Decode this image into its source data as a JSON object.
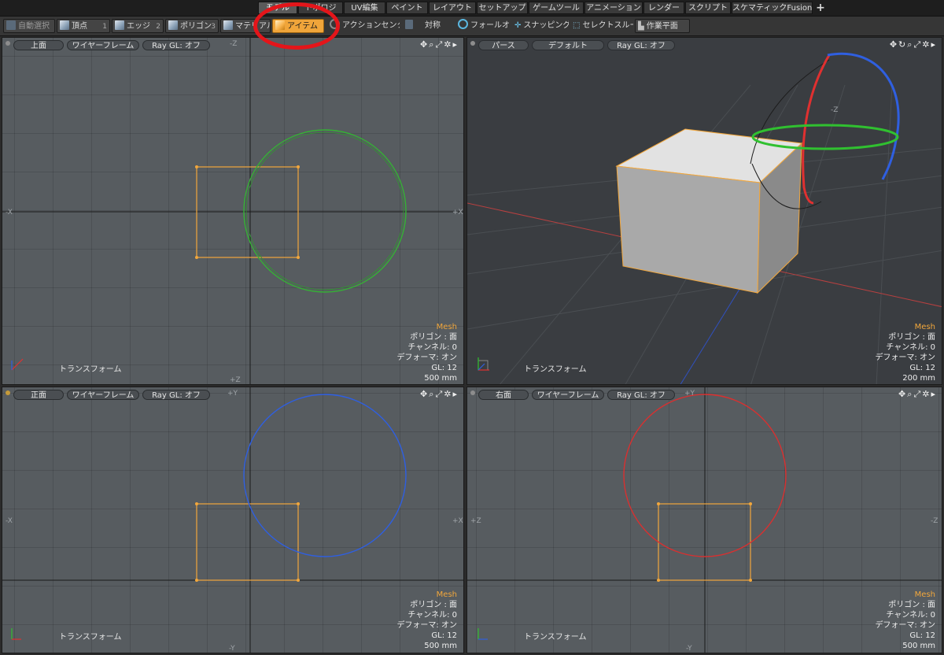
{
  "tabs": [
    {
      "label": "モデル",
      "active": true
    },
    {
      "label": "トポロジ",
      "active": false
    },
    {
      "label": "UV編集",
      "active": false
    },
    {
      "label": "ペイント",
      "active": false
    },
    {
      "label": "レイアウト",
      "active": false
    },
    {
      "label": "セットアップ",
      "active": false
    },
    {
      "label": "ゲームツール",
      "active": false
    },
    {
      "label": "アニメーション",
      "active": false
    },
    {
      "label": "レンダー",
      "active": false
    },
    {
      "label": "スクリプト",
      "active": false
    },
    {
      "label": "スケマティックFusion",
      "active": false
    }
  ],
  "tab_add_label": "+",
  "toolbar": {
    "auto_select": "自動選択",
    "vertex": "頂点",
    "vertex_key": "1",
    "edge": "エッジ",
    "edge_key": "2",
    "polygon": "ポリゴン",
    "polygon_key": "3",
    "material": "マテリアル",
    "item": "アイテム",
    "action_center": "アクションセンター",
    "symmetry": "対称",
    "falloff": "フォールオフ",
    "snapping": "スナッピング",
    "select_through": "セレクトスルー",
    "work_plane": "作業平面"
  },
  "viewports": {
    "top": {
      "view": "上面",
      "shading": "ワイヤーフレーム",
      "raygl": "Ray GL: オフ",
      "axis": {
        "top": "-Z",
        "bottom": "+Z",
        "left": "-X",
        "right": "+X"
      }
    },
    "persp": {
      "view": "パース",
      "shading": "デフォルト",
      "raygl": "Ray GL: オフ",
      "gizmo_label": "-Z"
    },
    "front": {
      "view": "正面",
      "shading": "ワイヤーフレーム",
      "raygl": "Ray GL: オフ",
      "axis": {
        "top": "+Y",
        "bottom": "-Y",
        "left": "-X",
        "right": "+X"
      }
    },
    "right": {
      "view": "右面",
      "shading": "ワイヤーフレーム",
      "raygl": "Ray GL: オフ",
      "axis": {
        "top": "+Y",
        "bottom": "-Y",
        "left": "+Z",
        "right": "-Z"
      }
    }
  },
  "info": {
    "mesh": "Mesh",
    "polygon": "ポリゴン : 面",
    "channel": "チャンネル: 0",
    "deformer": "デフォーマ: オン",
    "gl": "GL: 12",
    "scale_ortho": "500 mm",
    "scale_persp": "200 mm"
  },
  "transform_label": "トランスフォーム",
  "colors": {
    "selection": "#f2a73c",
    "x_axis": "#e03030",
    "y_axis": "#30c030",
    "z_axis": "#2f5fe0",
    "annotation": "#e4151a"
  }
}
